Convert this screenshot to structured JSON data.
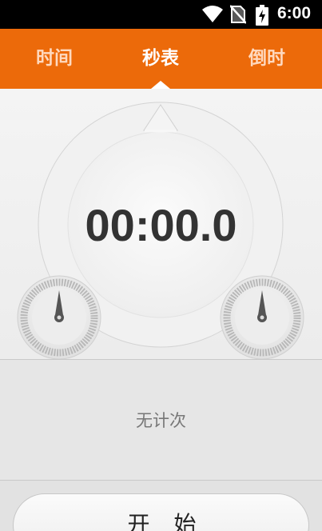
{
  "status_bar": {
    "time": "6:00",
    "icons": [
      "wifi-icon",
      "no-sim-icon",
      "battery-charging-icon"
    ]
  },
  "tabs": [
    {
      "label": "时间",
      "active": false
    },
    {
      "label": "秒表",
      "active": true
    },
    {
      "label": "倒时",
      "active": false
    }
  ],
  "stopwatch": {
    "display": "00:00.0",
    "sub_dials": [
      "left-sub-dial",
      "right-sub-dial"
    ]
  },
  "laps": {
    "empty_text": "无计次"
  },
  "controls": {
    "start_label": "开始"
  },
  "colors": {
    "accent": "#ec6a0a",
    "status_bar": "#000000",
    "text_primary": "#333333",
    "text_secondary": "#777777"
  }
}
